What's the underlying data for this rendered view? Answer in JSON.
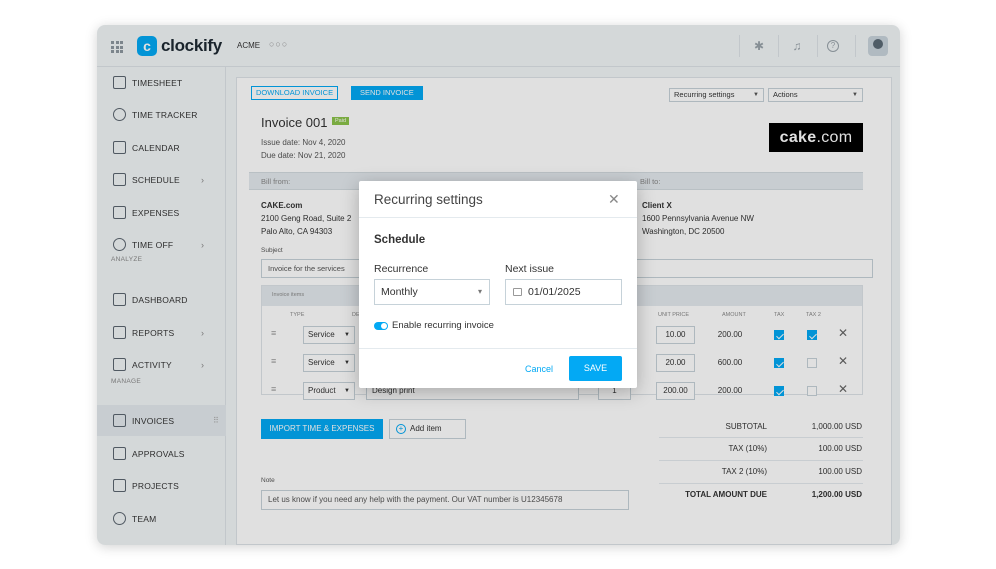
{
  "app": {
    "logo_mark": "c",
    "logo_text": "clockify",
    "workspace": "ACME",
    "workspace_dots": "○○○"
  },
  "sidebar": {
    "items": [
      {
        "label": "TIMESHEET",
        "icon": "timesheet-icon"
      },
      {
        "label": "TIME TRACKER",
        "icon": "clock-icon"
      },
      {
        "label": "CALENDAR",
        "icon": "calendar-icon"
      },
      {
        "label": "SCHEDULE",
        "icon": "schedule-icon",
        "chevron": "›"
      },
      {
        "label": "EXPENSES",
        "icon": "receipt-icon"
      },
      {
        "label": "TIME OFF",
        "icon": "time-off-icon",
        "chevron": "›"
      },
      {
        "label": "DASHBOARD",
        "icon": "dashboard-icon"
      },
      {
        "label": "REPORTS",
        "icon": "reports-icon",
        "chevron": "›"
      },
      {
        "label": "ACTIVITY",
        "icon": "activity-icon",
        "chevron": "›"
      },
      {
        "label": "INVOICES",
        "icon": "invoices-icon",
        "active": true
      },
      {
        "label": "APPROVALS",
        "icon": "approvals-icon"
      },
      {
        "label": "PROJECTS",
        "icon": "projects-icon"
      },
      {
        "label": "TEAM",
        "icon": "team-icon"
      }
    ],
    "sections": {
      "analyze": "ANALYZE",
      "manage": "MANAGE"
    },
    "drag_handle": "⠿"
  },
  "toolbar": {
    "download_label": "DOWNLOAD INVOICE",
    "send_label": "SEND INVOICE",
    "recurring_select": "Recurring settings",
    "actions_select": "Actions"
  },
  "invoice": {
    "title": "Invoice 001",
    "status": "Paid",
    "issue_date": "Issue date: Nov 4, 2020",
    "due_date": "Due date: Nov 21, 2020",
    "brand_bold": "cake",
    "brand_rest": ".com",
    "bill_from_label": "Bill from:",
    "bill_to_label": "Bill to:",
    "from": {
      "name": "CAKE.com",
      "line1": "2100 Geng Road, Suite 2",
      "line2": "Palo Alto, CA 94303"
    },
    "to": {
      "name": "Client X",
      "line1": "1600 Pennsylvania Avenue NW",
      "line2": "Washington, DC 20500"
    },
    "subject_label": "Subject",
    "subject_value": "Invoice for the services"
  },
  "items": {
    "panel_label": "Invoice items",
    "headers": {
      "type": "TYPE",
      "desc": "DE",
      "unit_price": "UNIT PRICE",
      "amount": "AMOUNT",
      "tax": "TAX",
      "tax2": "TAX 2"
    },
    "rows": [
      {
        "type": "Service",
        "description": "",
        "quantity": "",
        "unit_price": "10.00",
        "amount": "200.00",
        "tax": true,
        "tax2": true
      },
      {
        "type": "Service",
        "description": "",
        "quantity": "",
        "unit_price": "20.00",
        "amount": "600.00",
        "tax": true,
        "tax2": false
      },
      {
        "type": "Product",
        "description": "Design print",
        "quantity": "1",
        "unit_price": "200.00",
        "amount": "200.00",
        "tax": true,
        "tax2": false
      }
    ],
    "import_label": "IMPORT TIME & EXPENSES",
    "add_label": "Add item"
  },
  "totals": {
    "subtotal_label": "SUBTOTAL",
    "subtotal": "1,000.00 USD",
    "tax_label": "TAX (10%)",
    "tax": "100.00 USD",
    "tax2_label": "TAX 2 (10%)",
    "tax2": "100.00 USD",
    "total_label": "TOTAL AMOUNT DUE",
    "total": "1,200.00 USD"
  },
  "note": {
    "label": "Note",
    "value": "Let us know if you need any help with the payment. Our VAT number is U12345678"
  },
  "modal": {
    "title": "Recurring settings",
    "section": "Schedule",
    "recurrence_label": "Recurrence",
    "recurrence_value": "Monthly",
    "next_issue_label": "Next issue",
    "next_issue_value": "01/01/2025",
    "toggle_label": "Enable recurring invoice",
    "toggle_on": true,
    "cancel_label": "Cancel",
    "save_label": "SAVE"
  },
  "colors": {
    "accent": "#03a9f4",
    "paid": "#8bc34a",
    "sidebar_bg": "#f2f6f8"
  }
}
